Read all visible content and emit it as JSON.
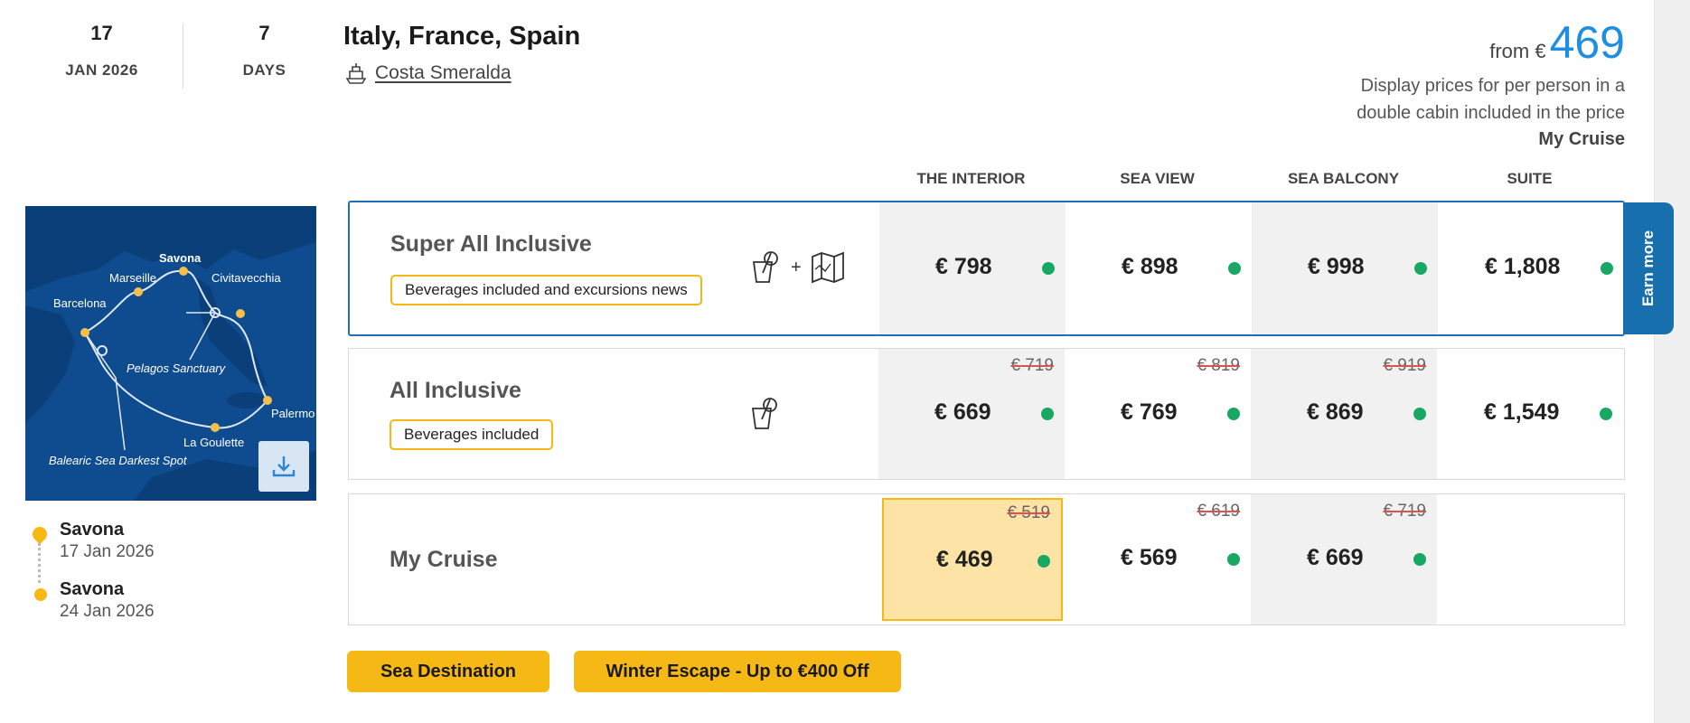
{
  "sailing": {
    "day": "17",
    "month_year": "JAN 2026",
    "duration": "7",
    "duration_label": "DAYS"
  },
  "title": "Italy, France, Spain",
  "ship": {
    "name": "Costa Smeralda",
    "icon": "ship-icon"
  },
  "price": {
    "from_label": "from €",
    "amount": "469",
    "note_line1": "Display prices for per person in a",
    "note_line2": "double cabin included in the price",
    "plan": "My Cruise"
  },
  "map": {
    "ports": [
      "Savona",
      "Marseille",
      "Civitavecchia",
      "Barcelona",
      "Pelagos Sanctuary",
      "Palermo",
      "La Goulette",
      "Balearic Sea Darkest Spot"
    ],
    "download_icon": "download-icon"
  },
  "itinerary": [
    {
      "port": "Savona",
      "date": "17 Jan 2026"
    },
    {
      "port": "Savona",
      "date": "24 Jan 2026"
    }
  ],
  "columns": [
    "THE INTERIOR",
    "SEA VIEW",
    "SEA BALCONY",
    "SUITE"
  ],
  "plans": [
    {
      "name": "Super All Inclusive",
      "tag": "Beverages included and excursions news",
      "icons": [
        "drinks-icon",
        "excursion-map-icon"
      ],
      "plus": "+",
      "prices": [
        {
          "amount": "€ 798",
          "old": ""
        },
        {
          "amount": "€ 898",
          "old": ""
        },
        {
          "amount": "€ 998",
          "old": ""
        },
        {
          "amount": "€ 1,808",
          "old": ""
        }
      ]
    },
    {
      "name": "All Inclusive",
      "tag": "Beverages included",
      "icons": [
        "drinks-icon"
      ],
      "prices": [
        {
          "amount": "€ 669",
          "old": "€ 719"
        },
        {
          "amount": "€ 769",
          "old": "€ 819"
        },
        {
          "amount": "€ 869",
          "old": "€ 919"
        },
        {
          "amount": "€ 1,549",
          "old": ""
        }
      ]
    },
    {
      "name": "My Cruise",
      "prices": [
        {
          "amount": "€ 469",
          "old": "€ 519"
        },
        {
          "amount": "€ 569",
          "old": "€ 619"
        },
        {
          "amount": "€ 669",
          "old": "€ 719"
        }
      ]
    }
  ],
  "earn_more": "Earn more",
  "badges": [
    "Sea Destination",
    "Winter Escape - Up to €400 Off"
  ],
  "colors": {
    "accent_blue": "#1e8ee3",
    "selected_border": "#1f6fb5",
    "promo_yellow": "#f5b814",
    "available_green": "#19a863"
  }
}
